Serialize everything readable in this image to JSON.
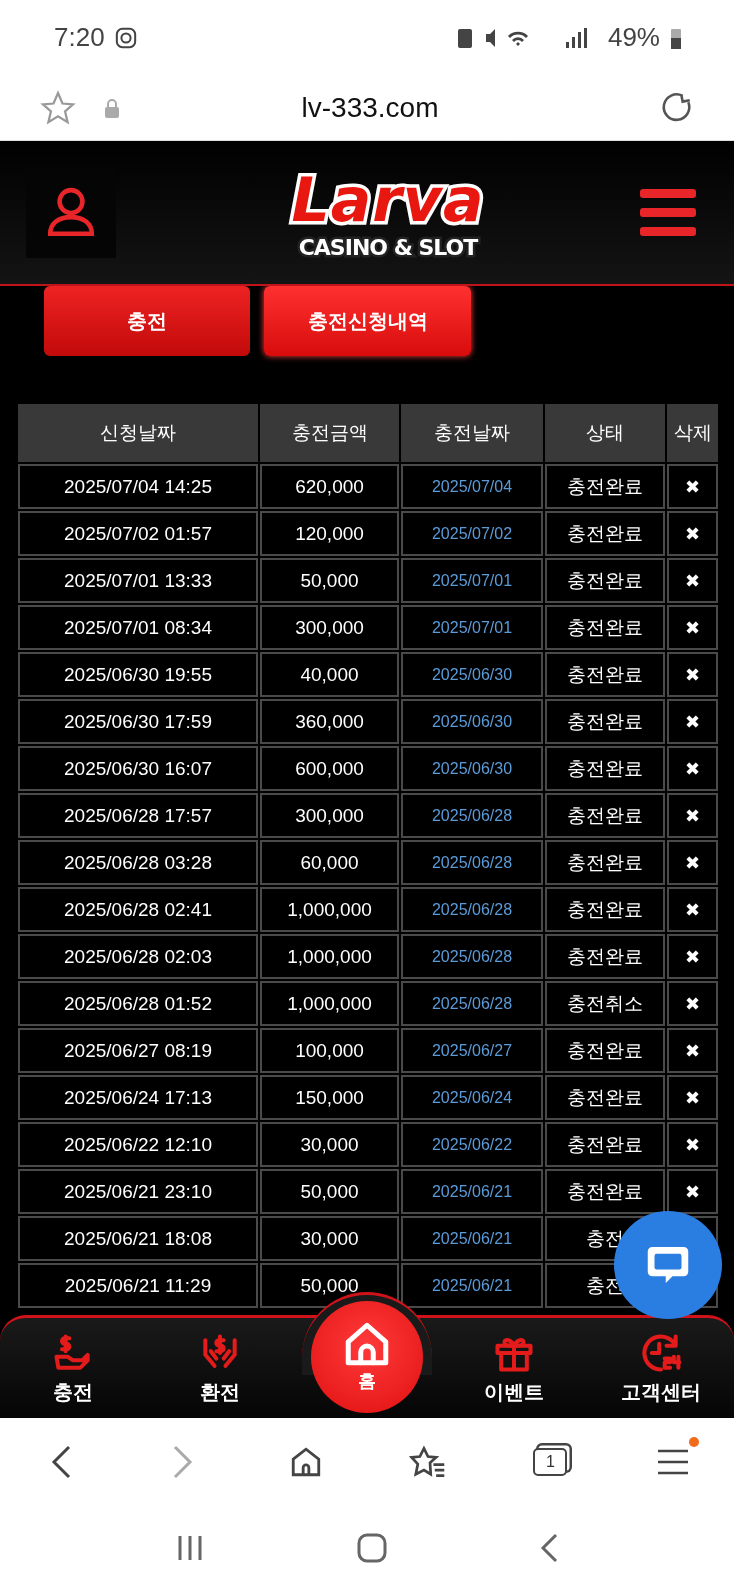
{
  "status_bar": {
    "time": "7:20",
    "battery": "49%"
  },
  "address_bar": {
    "url": "lv-333.com"
  },
  "logo": {
    "name": "Larva",
    "tagline": "CASINO & SLOT"
  },
  "tabs": [
    {
      "label": "충전",
      "selected": false
    },
    {
      "label": "충전신청내역",
      "selected": true
    }
  ],
  "table": {
    "columns": [
      "신청날짜",
      "충전금액",
      "충전날짜",
      "상태",
      "삭제"
    ],
    "rows": [
      {
        "requested": "2025/07/04 14:25",
        "amount": "620,000",
        "charged": "2025/07/04",
        "status": "충전완료",
        "delete": "✖"
      },
      {
        "requested": "2025/07/02 01:57",
        "amount": "120,000",
        "charged": "2025/07/02",
        "status": "충전완료",
        "delete": "✖"
      },
      {
        "requested": "2025/07/01 13:33",
        "amount": "50,000",
        "charged": "2025/07/01",
        "status": "충전완료",
        "delete": "✖"
      },
      {
        "requested": "2025/07/01 08:34",
        "amount": "300,000",
        "charged": "2025/07/01",
        "status": "충전완료",
        "delete": "✖"
      },
      {
        "requested": "2025/06/30 19:55",
        "amount": "40,000",
        "charged": "2025/06/30",
        "status": "충전완료",
        "delete": "✖"
      },
      {
        "requested": "2025/06/30 17:59",
        "amount": "360,000",
        "charged": "2025/06/30",
        "status": "충전완료",
        "delete": "✖"
      },
      {
        "requested": "2025/06/30 16:07",
        "amount": "600,000",
        "charged": "2025/06/30",
        "status": "충전완료",
        "delete": "✖"
      },
      {
        "requested": "2025/06/28 17:57",
        "amount": "300,000",
        "charged": "2025/06/28",
        "status": "충전완료",
        "delete": "✖"
      },
      {
        "requested": "2025/06/28 03:28",
        "amount": "60,000",
        "charged": "2025/06/28",
        "status": "충전완료",
        "delete": "✖"
      },
      {
        "requested": "2025/06/28 02:41",
        "amount": "1,000,000",
        "charged": "2025/06/28",
        "status": "충전완료",
        "delete": "✖"
      },
      {
        "requested": "2025/06/28 02:03",
        "amount": "1,000,000",
        "charged": "2025/06/28",
        "status": "충전완료",
        "delete": "✖"
      },
      {
        "requested": "2025/06/28 01:52",
        "amount": "1,000,000",
        "charged": "2025/06/28",
        "status": "충전취소",
        "delete": "✖"
      },
      {
        "requested": "2025/06/27 08:19",
        "amount": "100,000",
        "charged": "2025/06/27",
        "status": "충전완료",
        "delete": "✖"
      },
      {
        "requested": "2025/06/24 17:13",
        "amount": "150,000",
        "charged": "2025/06/24",
        "status": "충전완료",
        "delete": "✖"
      },
      {
        "requested": "2025/06/22 12:10",
        "amount": "30,000",
        "charged": "2025/06/22",
        "status": "충전완료",
        "delete": "✖"
      },
      {
        "requested": "2025/06/21 23:10",
        "amount": "50,000",
        "charged": "2025/06/21",
        "status": "충전완료",
        "delete": "✖"
      },
      {
        "requested": "2025/06/21 18:08",
        "amount": "30,000",
        "charged": "2025/06/21",
        "status": "충전"
      },
      {
        "requested": "2025/06/21 11:29",
        "amount": "50,000",
        "charged": "2025/06/21",
        "status": "충전"
      }
    ]
  },
  "bottom_nav": [
    {
      "label": "충전",
      "kind": "side"
    },
    {
      "label": "환전",
      "kind": "side"
    },
    {
      "label": "홈",
      "kind": "center"
    },
    {
      "label": "이벤트",
      "kind": "side"
    },
    {
      "label": "고객센터",
      "kind": "side"
    }
  ],
  "browser_toolbar": {
    "forward_disabled": true,
    "tab_count": "1",
    "menu_badge": true
  }
}
